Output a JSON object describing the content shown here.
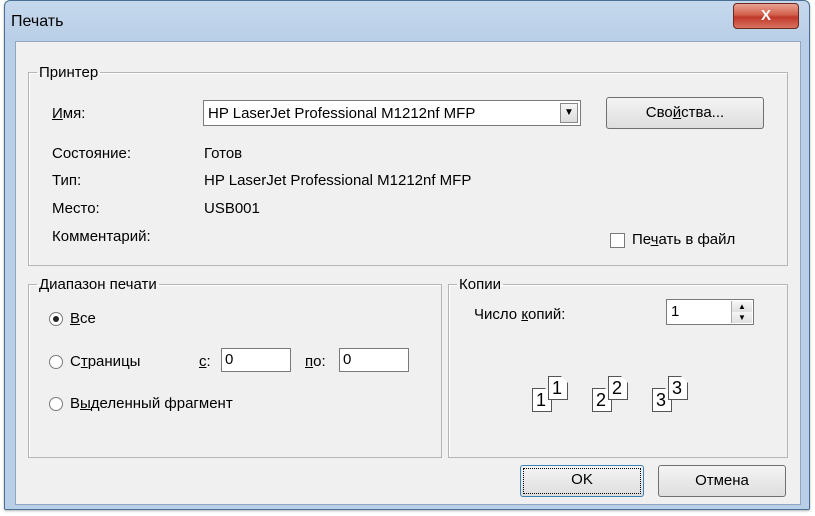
{
  "window": {
    "title": "Печать",
    "close_label": "X"
  },
  "printer_group": {
    "legend": "Принтер",
    "name_label_pre": "",
    "name_label_u": "И",
    "name_label_post": "мя:",
    "printer_name": "HP LaserJet Professional M1212nf MFP",
    "properties_pre": "Сво",
    "properties_u": "й",
    "properties_post": "ства...",
    "status_label": "Состояние:",
    "status_value": "Готов",
    "type_label": "Тип:",
    "type_value": "HP LaserJet Professional M1212nf MFP",
    "location_label": "Место:",
    "location_value": "USB001",
    "comment_label": "Комментарий:",
    "print_to_file_pre": "Пе",
    "print_to_file_u": "ч",
    "print_to_file_post": "ать в файл"
  },
  "range_group": {
    "legend": "Диапазон печати",
    "all_u": "В",
    "all_post": "се",
    "pages_pre": "С",
    "pages_u": "т",
    "pages_post": "раницы",
    "from_u": "с",
    "from_post": ":",
    "from_value": "0",
    "to_u": "п",
    "to_post": "о:",
    "to_value": "0",
    "selection_pre": "В",
    "selection_u": "ы",
    "selection_post": "деленный фрагмент"
  },
  "copies_group": {
    "legend": "Копии",
    "count_pre": "Число ",
    "count_u": "к",
    "count_post": "опий:",
    "count_value": "1",
    "collate_pages": [
      "1",
      "1",
      "2",
      "2",
      "3",
      "3"
    ]
  },
  "buttons": {
    "ok": "OK",
    "cancel": "Отмена"
  }
}
